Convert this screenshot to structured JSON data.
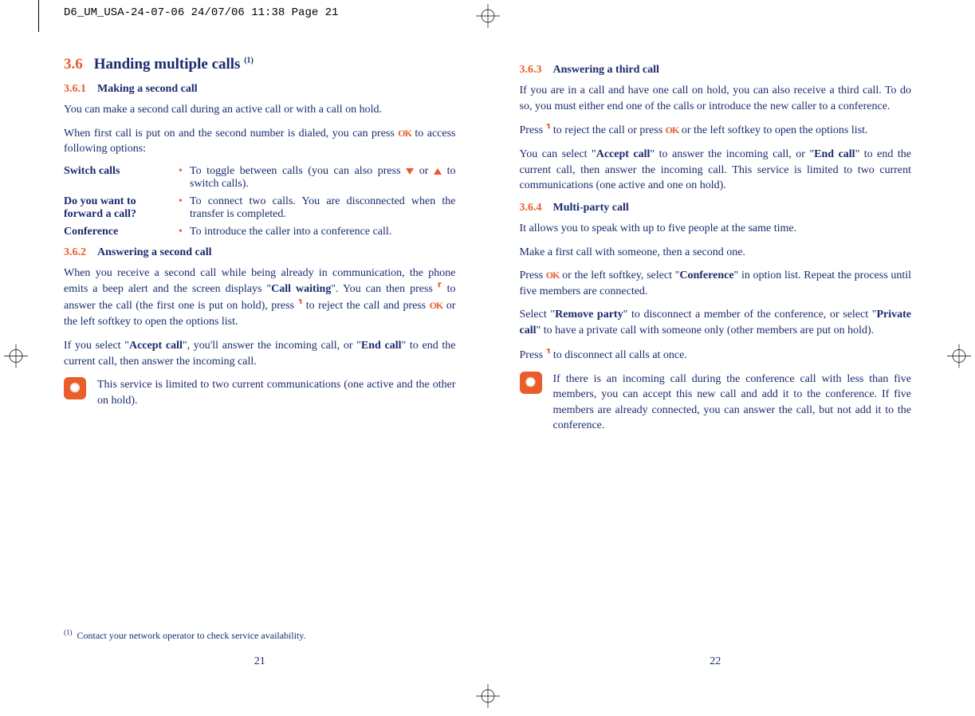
{
  "crop_header": "D6_UM_USA-24-07-06  24/07/06  11:38  Page 21",
  "left": {
    "h1_num": "3.6",
    "h1": "Handing multiple calls",
    "h1_sup": "(1)",
    "s361_num": "3.6.1",
    "s361_title": "Making a second call",
    "p1": "You can make a second call during an active call or with a call on hold.",
    "p2a": "When first call is put on and the second number is dialed, you can press ",
    "p2b": " to access following options:",
    "def1_term": "Switch calls",
    "def1_desc_a": "To toggle between calls (you can also press ",
    "def1_desc_b": " or ",
    "def1_desc_c": " to switch calls).",
    "def2_term_a": "Do you want to",
    "def2_term_b": "forward a call?",
    "def2_desc": "To connect two calls. You are disconnected when the transfer is completed.",
    "def3_term": "Conference",
    "def3_desc": "To introduce the caller into a conference call.",
    "s362_num": "3.6.2",
    "s362_title": "Answering a second call",
    "p3a": "When you receive a second call while being already in communication, the phone emits a beep alert and the screen displays \"",
    "p3b": "Call waiting",
    "p3c": "\". You can then press ",
    "p3d": " to answer the call (the first one is put on hold), press ",
    "p3e": " to reject the call and press ",
    "p3f": " or the left softkey to open the options list.",
    "p4a": "If you select \"",
    "p4b": "Accept call",
    "p4c": "\", you'll answer the incoming call, or \"",
    "p4d": "End call",
    "p4e": "\" to end the current call, then answer the incoming call.",
    "hint": "This service is limited to two current communications (one active and the other on hold).",
    "footnote_sup": "(1)",
    "footnote": "Contact your network operator to check service availability.",
    "pagenum": "21"
  },
  "right": {
    "s363_num": "3.6.3",
    "s363_title": "Answering a third call",
    "p1": "If you are in a call and have one call on hold, you can also receive a third call. To do so, you must either end one of the calls or introduce the new caller to a conference.",
    "p2a": "Press ",
    "p2b": " to reject the call or press ",
    "p2c": " or the left softkey to open the options list.",
    "p3a": "You can select \"",
    "p3b": "Accept call",
    "p3c": "\" to answer the incoming call, or \"",
    "p3d": "End call",
    "p3e": "\" to end the current call, then answer the incoming call. This service is limited to two current communications (one active and one on hold).",
    "s364_num": "3.6.4",
    "s364_title": "Multi-party call",
    "p4": "It allows you to speak with up to five people at the same time.",
    "p5": "Make a first call with someone, then a second one.",
    "p6a": "Press ",
    "p6b": " or the left softkey, select \"",
    "p6c": "Conference",
    "p6d": "\" in option list. Repeat the process until five members are connected.",
    "p7a": "Select \"",
    "p7b": "Remove party",
    "p7c": "\" to disconnect a member of the conference, or select \"",
    "p7d": "Private call",
    "p7e": "\" to have a private call with someone only (other members are put on hold).",
    "p8a": "Press ",
    "p8b": " to disconnect all calls at once.",
    "hint": "If there is an incoming call during the conference call with less than five members, you can accept this new call and add it to the conference. If five members are already connected, you can answer the call, but not add it to the conference.",
    "pagenum": "22"
  }
}
